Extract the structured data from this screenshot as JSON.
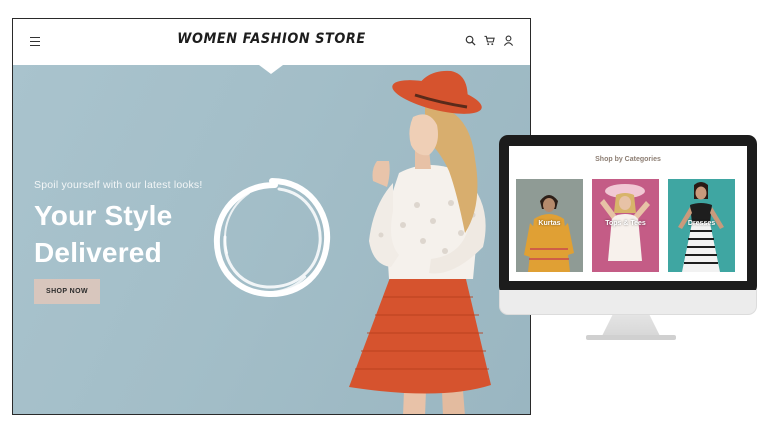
{
  "store": {
    "title": "WOMEN FASHION STORE"
  },
  "header_icons": [
    "menu-icon",
    "search-icon",
    "cart-icon",
    "user-icon"
  ],
  "hero": {
    "tagline": "Spoil yourself with our latest looks!",
    "headline_line1": "Your Style",
    "headline_line2": "Delivered",
    "cta_label": "SHOP NOW"
  },
  "categories_screen": {
    "heading": "Shop by Categories",
    "items": [
      {
        "label": "Kurtas"
      },
      {
        "label": "Tops & Tees"
      },
      {
        "label": "Dresses"
      }
    ]
  },
  "colors": {
    "hero_background": "#a6c0ca",
    "cta_background": "#d8c6bd",
    "hat_and_skirt": "#d6532e",
    "heading_brown": "#8d7e73"
  }
}
